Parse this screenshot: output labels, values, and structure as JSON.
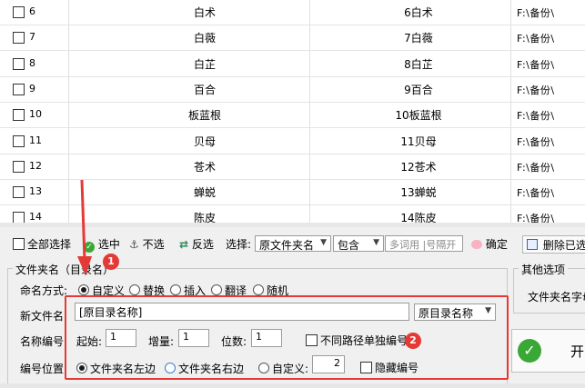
{
  "table": {
    "rows": [
      {
        "num": "6",
        "name": "白术",
        "new_name": "6白术",
        "path": "F:\\备份\\"
      },
      {
        "num": "7",
        "name": "白薇",
        "new_name": "7白薇",
        "path": "F:\\备份\\"
      },
      {
        "num": "8",
        "name": "白芷",
        "new_name": "8白芷",
        "path": "F:\\备份\\"
      },
      {
        "num": "9",
        "name": "百合",
        "new_name": "9百合",
        "path": "F:\\备份\\"
      },
      {
        "num": "10",
        "name": "板蓝根",
        "new_name": "10板蓝根",
        "path": "F:\\备份\\"
      },
      {
        "num": "11",
        "name": "贝母",
        "new_name": "11贝母",
        "path": "F:\\备份\\"
      },
      {
        "num": "12",
        "name": "苍术",
        "new_name": "12苍术",
        "path": "F:\\备份\\"
      },
      {
        "num": "13",
        "name": "蝉蜕",
        "new_name": "13蝉蜕",
        "path": "F:\\备份\\"
      },
      {
        "num": "14",
        "name": "陈皮",
        "new_name": "14陈皮",
        "path": "F:\\备份\\"
      }
    ]
  },
  "toolbar": {
    "select_all": "全部选择",
    "select": "选中",
    "unselect": "不选",
    "invert": "反选",
    "choose_label": "选择:",
    "source_value": "原文件夹名",
    "match_value": "包含",
    "keyword_placeholder": "多词用 |号隔开",
    "confirm": "确定",
    "delete": "删除已选"
  },
  "folder_group": {
    "title": "文件夹名（目录名）",
    "naming_label": "命名方式:",
    "modes": [
      "自定义",
      "替换",
      "插入",
      "翻译",
      "随机"
    ],
    "new_name_label": "新文件名:",
    "new_name_value": "[原目录名称]",
    "template_select": "原目录名称",
    "number_label": "名称编号:",
    "start_label": "起始:",
    "start_value": "1",
    "step_label": "增量:",
    "step_value": "1",
    "digits_label": "位数:",
    "digits_value": "1",
    "separate_label": "不同路径单独编号",
    "position_label": "编号位置:",
    "positions": [
      "文件夹名左边",
      "文件夹名右边",
      "自定义:"
    ],
    "custom_value": "2",
    "hide_label": "隐藏编号"
  },
  "other_group": {
    "title": "其他选项",
    "text": "文件夹名字母"
  },
  "start_button": {
    "label": "开"
  },
  "annotations": {
    "badge1": "1",
    "badge2": "2"
  },
  "colors": {
    "accent_red": "#e53935",
    "start_green": "#3aa835"
  }
}
